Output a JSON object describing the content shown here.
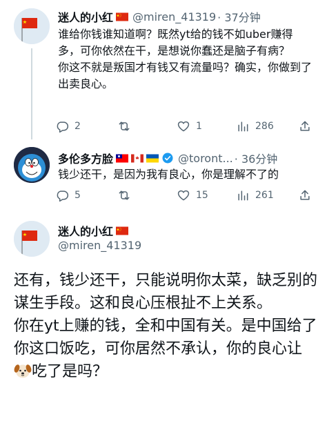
{
  "tweets": [
    {
      "display_name": "迷人的小红",
      "handle": "@miren_41319",
      "time": "· 37分钟",
      "text": "谁给你钱谁知道啊？既然yt给的钱不如uber赚得多，可你依然在干，是想说你蠢还是脑子有病？\n你这不就是叛国才有钱又有流量吗？确实，你做到了出卖良心。",
      "reply_count": "2",
      "retweet_count": "",
      "like_count": "1",
      "view_count": "286"
    },
    {
      "display_name": "多伦多方脸",
      "handle": "@toront...",
      "time": "· 36分钟",
      "text": "钱少还干，是因为我有良心，你是理解不了的",
      "reply_count": "5",
      "retweet_count": "",
      "like_count": "15",
      "view_count": "261"
    }
  ],
  "main_tweet": {
    "display_name": "迷人的小红",
    "handle": "@miren_41319",
    "text_part1": "还有，钱少还干，只能说明你太菜，缺乏别的谋生手段。这和良心压根扯不上关系。\n你在yt上赚的钱，全和中国有关。是中国给了你这口饭吃，可你居然不承认，你的良心让",
    "text_part2": "吃了是吗？"
  },
  "icons": {
    "reply": "reply-icon",
    "retweet": "retweet-icon",
    "like": "like-icon",
    "views": "views-icon",
    "share": "share-icon",
    "verified": "verified-badge-icon",
    "dog": "dog-face-emoji"
  },
  "colors": {
    "muted": "#536471",
    "verified": "#1d9bf0",
    "flag_red": "#de2910",
    "flag_yellow": "#ffde00"
  }
}
